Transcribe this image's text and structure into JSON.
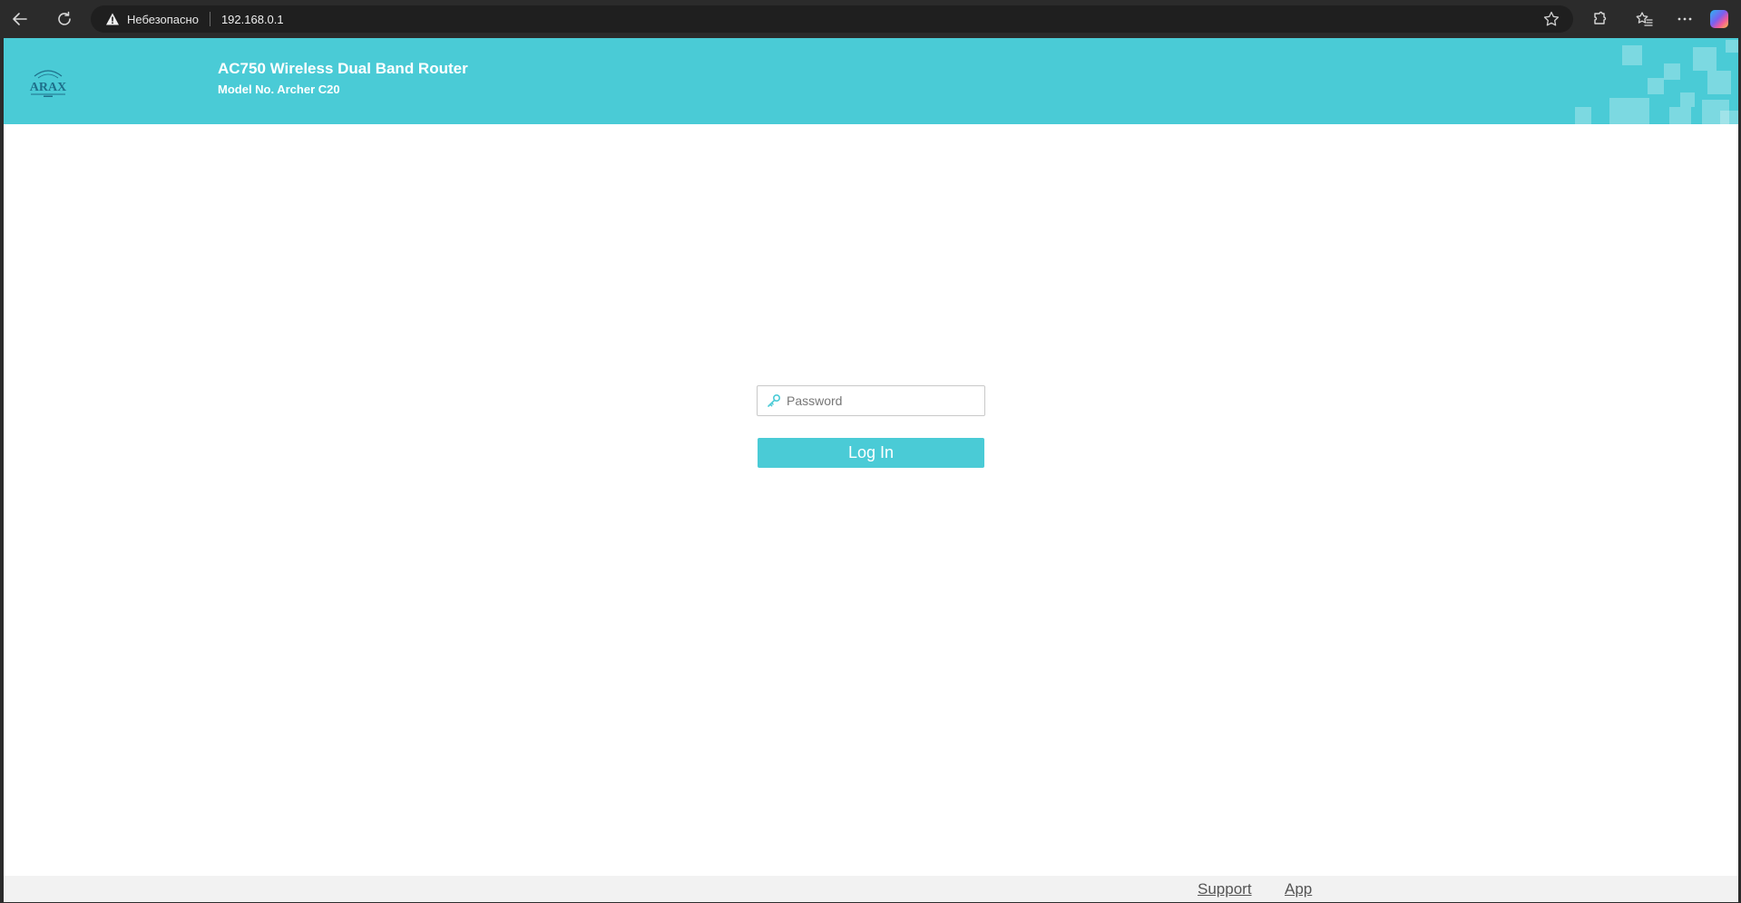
{
  "browser": {
    "security_label": "Небезопасно",
    "url": "192.168.0.1"
  },
  "header": {
    "logo_text": "ARAX",
    "title": "AC750 Wireless Dual Band Router",
    "model": "Model No. Archer C20",
    "background_color": "#4acbd6"
  },
  "login": {
    "password_placeholder": "Password",
    "password_value": "",
    "button_label": "Log In",
    "button_color": "#4acbd6"
  },
  "footer": {
    "links": [
      "Support",
      "App"
    ]
  },
  "icons": {
    "back": "back-arrow-icon",
    "reload": "reload-icon",
    "warning": "warning-triangle-icon",
    "favorite": "star-icon",
    "extensions": "extensions-icon",
    "favorites_list": "favorites-list-icon",
    "menu": "more-options-icon",
    "copilot": "copilot-icon",
    "key": "key-icon"
  }
}
